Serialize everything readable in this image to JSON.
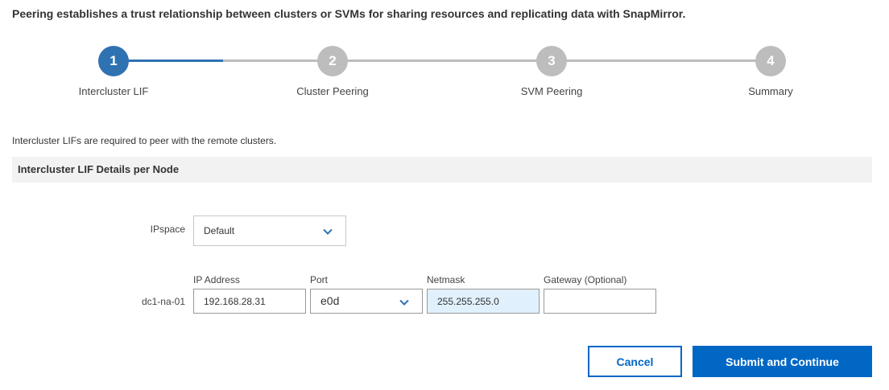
{
  "intro": "Peering establishes a trust relationship between clusters or SVMs for sharing resources and replicating data with SnapMirror.",
  "steps": [
    {
      "number": "1",
      "label": "Intercluster LIF"
    },
    {
      "number": "2",
      "label": "Cluster Peering"
    },
    {
      "number": "3",
      "label": "SVM Peering"
    },
    {
      "number": "4",
      "label": "Summary"
    }
  ],
  "subtitle": "Intercluster LIFs are required to peer with the remote clusters.",
  "section_header": "Intercluster LIF Details per Node",
  "ipspace": {
    "label": "IPspace",
    "value": "Default"
  },
  "columns": {
    "ip": "IP Address",
    "port": "Port",
    "netmask": "Netmask",
    "gateway": "Gateway (Optional)"
  },
  "row": {
    "node": "dc1-na-01",
    "ip": "192.168.28.31",
    "port": "e0d",
    "netmask": "255.255.255.0",
    "gateway": ""
  },
  "buttons": {
    "cancel": "Cancel",
    "submit": "Submit and Continue"
  },
  "colors": {
    "accent": "#2f72b2",
    "primary": "#0067c5",
    "inactive": "#bdbdbd"
  }
}
